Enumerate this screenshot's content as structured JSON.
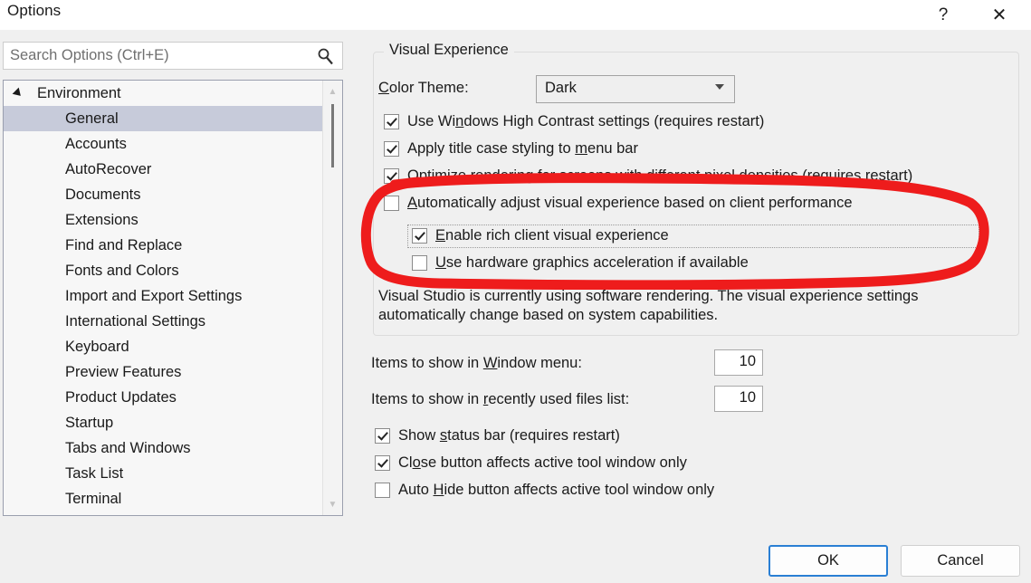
{
  "window": {
    "title": "Options",
    "help_icon": "question-mark-icon",
    "close_icon": "close-icon"
  },
  "search": {
    "placeholder": "Search Options (Ctrl+E)",
    "value": "",
    "icon": "search-icon"
  },
  "sidebar": {
    "root": {
      "label": "Environment",
      "expanded": true
    },
    "items": [
      {
        "label": "General",
        "selected": true
      },
      {
        "label": "Accounts",
        "selected": false
      },
      {
        "label": "AutoRecover",
        "selected": false
      },
      {
        "label": "Documents",
        "selected": false
      },
      {
        "label": "Extensions",
        "selected": false
      },
      {
        "label": "Find and Replace",
        "selected": false
      },
      {
        "label": "Fonts and Colors",
        "selected": false
      },
      {
        "label": "Import and Export Settings",
        "selected": false
      },
      {
        "label": "International Settings",
        "selected": false
      },
      {
        "label": "Keyboard",
        "selected": false
      },
      {
        "label": "Preview Features",
        "selected": false
      },
      {
        "label": "Product Updates",
        "selected": false
      },
      {
        "label": "Startup",
        "selected": false
      },
      {
        "label": "Tabs and Windows",
        "selected": false
      },
      {
        "label": "Task List",
        "selected": false
      },
      {
        "label": "Terminal",
        "selected": false
      }
    ]
  },
  "main": {
    "group_title": "Visual Experience",
    "color_theme": {
      "label_pre": "C",
      "label_post": "olor Theme:",
      "value": "Dark"
    },
    "checkboxes": {
      "high_contrast": {
        "pre": "Use Wi",
        "acc": "n",
        "post": "dows High Contrast settings (requires restart)",
        "checked": true
      },
      "title_case": {
        "pre": "Apply title case styling to ",
        "acc": "m",
        "post": "enu bar",
        "checked": true
      },
      "optimize_rendering": {
        "pre": "",
        "acc": "O",
        "post": "ptimize rendering for screens with different pixel densities (requires restart)",
        "checked": true
      },
      "auto_adjust": {
        "pre": "",
        "acc": "A",
        "post": "utomatically adjust visual experience based on client performance",
        "checked": false
      },
      "rich_client": {
        "pre": "",
        "acc": "E",
        "post": "nable rich client visual experience",
        "checked": true,
        "focused": true
      },
      "hardware_accel": {
        "pre": "",
        "acc": "U",
        "post": "se hardware graphics acceleration if available",
        "checked": false
      },
      "status_bar": {
        "pre": "Show ",
        "acc": "s",
        "post": "tatus bar (requires restart)",
        "checked": true
      },
      "close_button": {
        "pre": "Cl",
        "acc": "o",
        "post": "se button affects active tool window only",
        "checked": true
      },
      "auto_hide": {
        "pre": "Auto ",
        "acc": "H",
        "post": "ide button affects active tool window only",
        "checked": false
      }
    },
    "description": "Visual Studio is currently using software rendering.  The visual experience settings automatically change based on system capabilities.",
    "window_menu": {
      "pre": "Items to show in ",
      "acc": "W",
      "post": "indow menu:",
      "value": "10"
    },
    "recent_files": {
      "pre": "Items to show in ",
      "acc": "r",
      "post": "ecently used files list:",
      "value": "10"
    }
  },
  "footer": {
    "ok_label": "OK",
    "cancel_label": "Cancel"
  },
  "annotation": {
    "shape": "hand-drawn-red-rounded-rectangle",
    "color": "#ee1c1c"
  },
  "colors": {
    "selection": "#c7cbda",
    "accent": "#2a7fd4",
    "annotation_red": "#ee1c1c",
    "page_background": "#f0f0f0",
    "tree_background": "#f7f7f7"
  }
}
